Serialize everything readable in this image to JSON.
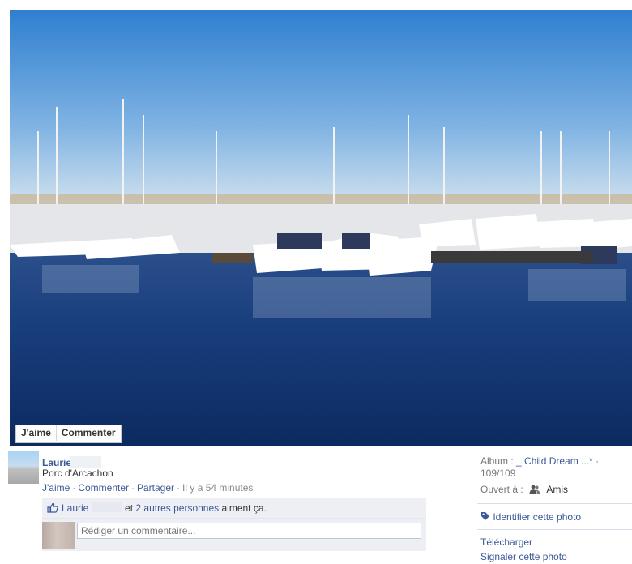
{
  "photo": {
    "description_icon": "marina-photo",
    "actions": {
      "like": "J'aime",
      "comment": "Commenter"
    }
  },
  "post": {
    "author": "Laurie",
    "caption": "Porc d'Arcachon",
    "actions": {
      "like": "J'aime",
      "comment": "Commenter",
      "share": "Partager",
      "time": "Il y a 54 minutes"
    }
  },
  "likes": {
    "name": "Laurie",
    "others_link": "2 autres personnes",
    "suffix": "aiment ça.",
    "et": "et"
  },
  "comment": {
    "placeholder": "Rédiger un commentaire..."
  },
  "sidebar": {
    "album_label": "Album :",
    "album_name": "_ Child Dream ...*",
    "album_count": "· 109/109",
    "open_label": "Ouvert à :",
    "open_value": "Amis",
    "tag_photo": "Identifier cette photo",
    "download": "Télécharger",
    "report": "Signaler cette photo"
  },
  "colors": {
    "link": "#3b5998",
    "meta": "#888888"
  }
}
